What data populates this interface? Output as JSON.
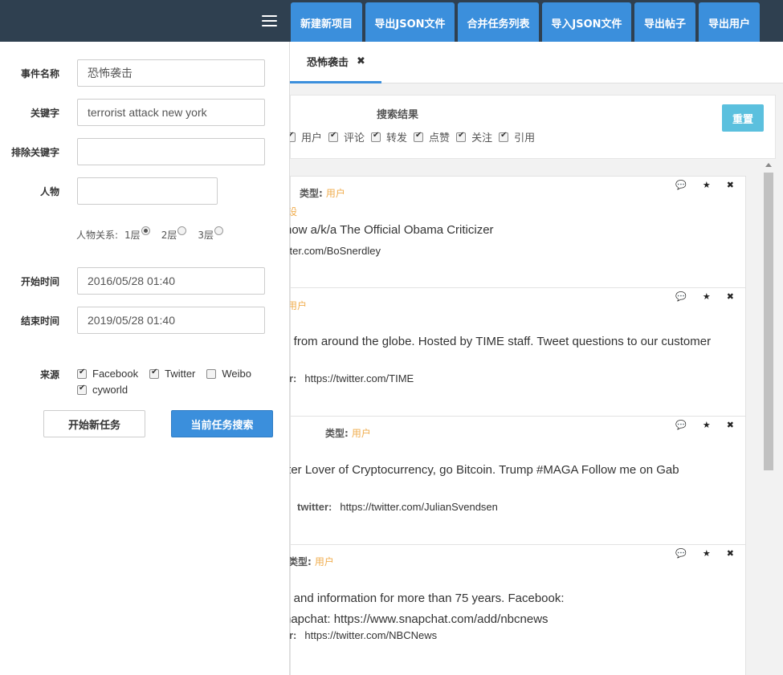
{
  "toolbar": {
    "buttons": [
      "新建新项目",
      "导出JSON文件",
      "合并任务列表",
      "导入JSON文件",
      "导出帖子",
      "导出用户"
    ]
  },
  "form": {
    "event_name_label": "事件名称",
    "event_name_value": "恐怖袭击",
    "keyword_label": "关键字",
    "keyword_value": "terrorist attack new york",
    "exclude_label": "排除关键字",
    "exclude_value": "",
    "person_label": "人物",
    "person_value": "",
    "relation_label": "人物关系:",
    "relation_options": [
      "1层",
      "2层",
      "3层"
    ],
    "relation_selected": "1层",
    "start_label": "开始时间",
    "start_value": "2016/05/28 01:40",
    "end_label": "结束时间",
    "end_value": "2019/05/28 01:40",
    "source_label": "来源",
    "sources": [
      {
        "label": "Facebook",
        "checked": true
      },
      {
        "label": "Twitter",
        "checked": true
      },
      {
        "label": "Weibo",
        "checked": false
      },
      {
        "label": "cyworld",
        "checked": true
      }
    ],
    "new_task_button": "开始新任务",
    "current_search_button": "当前任务搜索"
  },
  "tab": {
    "label": "恐怖袭击",
    "close": "×"
  },
  "results": {
    "title": "搜索结果",
    "filters": [
      "用户",
      "评论",
      "转发",
      "点赞",
      "关注",
      "引用"
    ],
    "reset_button": "重置"
  },
  "cards": [
    {
      "type_label": "类型:",
      "type_value": "用户",
      "extra": "设",
      "desc": "how a/k/a The Official Obama Criticizer",
      "link_label": "",
      "link": "itter.com/BoSnerdley"
    },
    {
      "type_label": "",
      "type_value": "",
      "extra": "用户",
      "desc": "s from around the globe. Hosted by TIME staff. Tweet questions to our customer",
      "link_label": "r:",
      "link": "https://twitter.com/TIME"
    },
    {
      "type_label": "类型:",
      "type_value": "用户",
      "extra": "",
      "desc": "tter Lover of Cryptocurrency, go Bitcoin. Trump #MAGA Follow me on Gab",
      "link_label": "twitter:",
      "link": "https://twitter.com/JulianSvendsen"
    },
    {
      "type_label": "类型:",
      "type_value": "用户",
      "extra": "",
      "desc": "s and information for more than 75 years. Facebook:",
      "desc2": "napchat: https://www.snapchat.com/add/nbcnews",
      "link_label": "r:",
      "link": "https://twitter.com/NBCNews"
    }
  ],
  "icons": {
    "comment": "comment-icon",
    "star": "star-icon",
    "close": "close-icon",
    "menu": "hamburger-icon"
  },
  "colors": {
    "topbar": "#2f4050",
    "primary": "#3b8fdc",
    "info": "#5bc0de",
    "type_value": "#f0ad4e"
  }
}
